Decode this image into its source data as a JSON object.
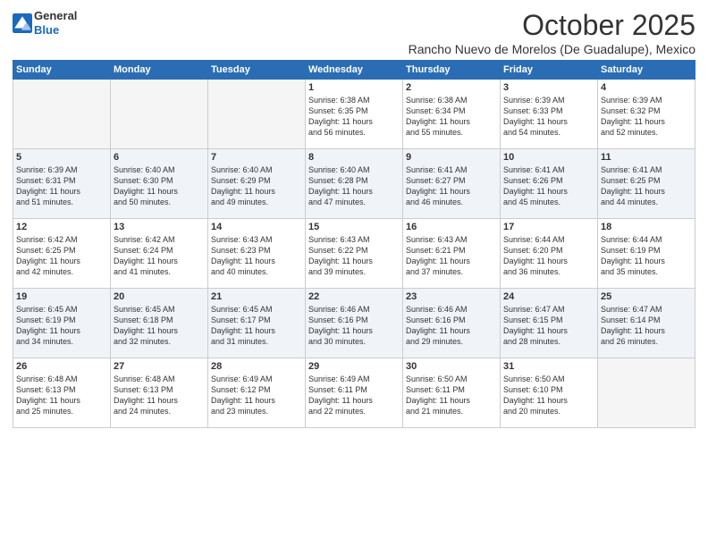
{
  "header": {
    "logo_general": "General",
    "logo_blue": "Blue",
    "month": "October 2025",
    "location": "Rancho Nuevo de Morelos (De Guadalupe), Mexico"
  },
  "days_of_week": [
    "Sunday",
    "Monday",
    "Tuesday",
    "Wednesday",
    "Thursday",
    "Friday",
    "Saturday"
  ],
  "weeks": [
    [
      {
        "day": "",
        "content": ""
      },
      {
        "day": "",
        "content": ""
      },
      {
        "day": "",
        "content": ""
      },
      {
        "day": "1",
        "content": "Sunrise: 6:38 AM\nSunset: 6:35 PM\nDaylight: 11 hours\nand 56 minutes."
      },
      {
        "day": "2",
        "content": "Sunrise: 6:38 AM\nSunset: 6:34 PM\nDaylight: 11 hours\nand 55 minutes."
      },
      {
        "day": "3",
        "content": "Sunrise: 6:39 AM\nSunset: 6:33 PM\nDaylight: 11 hours\nand 54 minutes."
      },
      {
        "day": "4",
        "content": "Sunrise: 6:39 AM\nSunset: 6:32 PM\nDaylight: 11 hours\nand 52 minutes."
      }
    ],
    [
      {
        "day": "5",
        "content": "Sunrise: 6:39 AM\nSunset: 6:31 PM\nDaylight: 11 hours\nand 51 minutes."
      },
      {
        "day": "6",
        "content": "Sunrise: 6:40 AM\nSunset: 6:30 PM\nDaylight: 11 hours\nand 50 minutes."
      },
      {
        "day": "7",
        "content": "Sunrise: 6:40 AM\nSunset: 6:29 PM\nDaylight: 11 hours\nand 49 minutes."
      },
      {
        "day": "8",
        "content": "Sunrise: 6:40 AM\nSunset: 6:28 PM\nDaylight: 11 hours\nand 47 minutes."
      },
      {
        "day": "9",
        "content": "Sunrise: 6:41 AM\nSunset: 6:27 PM\nDaylight: 11 hours\nand 46 minutes."
      },
      {
        "day": "10",
        "content": "Sunrise: 6:41 AM\nSunset: 6:26 PM\nDaylight: 11 hours\nand 45 minutes."
      },
      {
        "day": "11",
        "content": "Sunrise: 6:41 AM\nSunset: 6:25 PM\nDaylight: 11 hours\nand 44 minutes."
      }
    ],
    [
      {
        "day": "12",
        "content": "Sunrise: 6:42 AM\nSunset: 6:25 PM\nDaylight: 11 hours\nand 42 minutes."
      },
      {
        "day": "13",
        "content": "Sunrise: 6:42 AM\nSunset: 6:24 PM\nDaylight: 11 hours\nand 41 minutes."
      },
      {
        "day": "14",
        "content": "Sunrise: 6:43 AM\nSunset: 6:23 PM\nDaylight: 11 hours\nand 40 minutes."
      },
      {
        "day": "15",
        "content": "Sunrise: 6:43 AM\nSunset: 6:22 PM\nDaylight: 11 hours\nand 39 minutes."
      },
      {
        "day": "16",
        "content": "Sunrise: 6:43 AM\nSunset: 6:21 PM\nDaylight: 11 hours\nand 37 minutes."
      },
      {
        "day": "17",
        "content": "Sunrise: 6:44 AM\nSunset: 6:20 PM\nDaylight: 11 hours\nand 36 minutes."
      },
      {
        "day": "18",
        "content": "Sunrise: 6:44 AM\nSunset: 6:19 PM\nDaylight: 11 hours\nand 35 minutes."
      }
    ],
    [
      {
        "day": "19",
        "content": "Sunrise: 6:45 AM\nSunset: 6:19 PM\nDaylight: 11 hours\nand 34 minutes."
      },
      {
        "day": "20",
        "content": "Sunrise: 6:45 AM\nSunset: 6:18 PM\nDaylight: 11 hours\nand 32 minutes."
      },
      {
        "day": "21",
        "content": "Sunrise: 6:45 AM\nSunset: 6:17 PM\nDaylight: 11 hours\nand 31 minutes."
      },
      {
        "day": "22",
        "content": "Sunrise: 6:46 AM\nSunset: 6:16 PM\nDaylight: 11 hours\nand 30 minutes."
      },
      {
        "day": "23",
        "content": "Sunrise: 6:46 AM\nSunset: 6:16 PM\nDaylight: 11 hours\nand 29 minutes."
      },
      {
        "day": "24",
        "content": "Sunrise: 6:47 AM\nSunset: 6:15 PM\nDaylight: 11 hours\nand 28 minutes."
      },
      {
        "day": "25",
        "content": "Sunrise: 6:47 AM\nSunset: 6:14 PM\nDaylight: 11 hours\nand 26 minutes."
      }
    ],
    [
      {
        "day": "26",
        "content": "Sunrise: 6:48 AM\nSunset: 6:13 PM\nDaylight: 11 hours\nand 25 minutes."
      },
      {
        "day": "27",
        "content": "Sunrise: 6:48 AM\nSunset: 6:13 PM\nDaylight: 11 hours\nand 24 minutes."
      },
      {
        "day": "28",
        "content": "Sunrise: 6:49 AM\nSunset: 6:12 PM\nDaylight: 11 hours\nand 23 minutes."
      },
      {
        "day": "29",
        "content": "Sunrise: 6:49 AM\nSunset: 6:11 PM\nDaylight: 11 hours\nand 22 minutes."
      },
      {
        "day": "30",
        "content": "Sunrise: 6:50 AM\nSunset: 6:11 PM\nDaylight: 11 hours\nand 21 minutes."
      },
      {
        "day": "31",
        "content": "Sunrise: 6:50 AM\nSunset: 6:10 PM\nDaylight: 11 hours\nand 20 minutes."
      },
      {
        "day": "",
        "content": ""
      }
    ]
  ]
}
